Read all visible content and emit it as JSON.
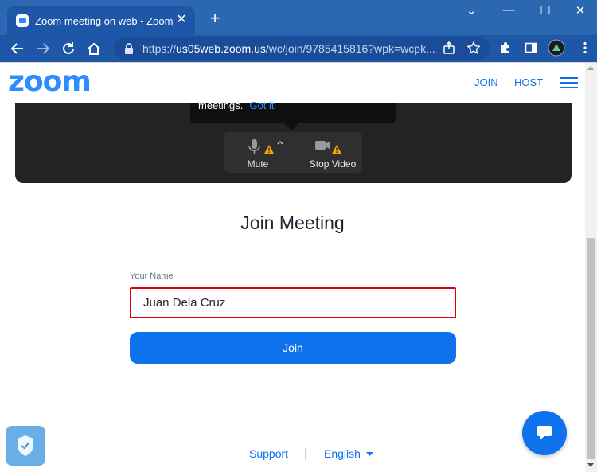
{
  "browser": {
    "tab_title": "Zoom meeting on web - Zoom",
    "tab_close": "✕",
    "new_tab": "+",
    "window_controls": {
      "collapse": "⌄",
      "minimize": "—",
      "maximize": "☐",
      "close": "✕"
    },
    "url_prefix": "https://",
    "url_host": "us05web.zoom.us",
    "url_path": "/wc/join/9785415816?wpk=wcpk...",
    "icons": [
      "back-icon",
      "forward-icon",
      "reload-icon",
      "home-icon",
      "lock-icon",
      "share-icon",
      "star-icon",
      "extensions-icon",
      "sidebar-icon",
      "profile-avatar",
      "menu-kebab-icon"
    ]
  },
  "header": {
    "logo": "zoom",
    "nav": {
      "join": "JOIN",
      "host": "HOST"
    },
    "accent_color": "#0e72ed"
  },
  "preview": {
    "tooltip_text": "meetings.",
    "tooltip_link": "Got it",
    "mute_label": "Mute",
    "video_label": "Stop Video"
  },
  "join_form": {
    "title": "Join Meeting",
    "name_label": "Your Name",
    "name_value": "Juan Dela Cruz",
    "join_button": "Join",
    "highlight_color": "#e0000b"
  },
  "footer": {
    "support": "Support",
    "language": "English"
  }
}
